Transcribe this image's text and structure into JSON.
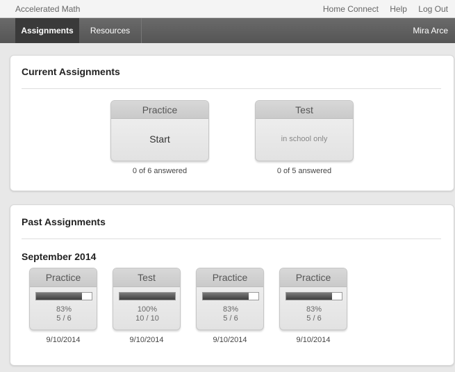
{
  "app": {
    "name": "Accelerated Math"
  },
  "top_links": [
    "Home Connect",
    "Help",
    "Log Out"
  ],
  "nav": {
    "tabs": [
      "Assignments",
      "Resources"
    ],
    "user": "Mira Arce"
  },
  "current": {
    "title": "Current Assignments",
    "cards": [
      {
        "type": "Practice",
        "action": "Start",
        "answered": "0 of 6 answered"
      },
      {
        "type": "Test",
        "action": "in school only",
        "answered": "0 of 5 answered"
      }
    ]
  },
  "past": {
    "title": "Past Assignments",
    "month": "September 2014",
    "cards": [
      {
        "type": "Practice",
        "percent": "83%",
        "score": "5 / 6",
        "progress": 0.83,
        "date": "9/10/2014"
      },
      {
        "type": "Test",
        "percent": "100%",
        "score": "10 / 10",
        "progress": 1.0,
        "date": "9/10/2014"
      },
      {
        "type": "Practice",
        "percent": "83%",
        "score": "5 / 6",
        "progress": 0.83,
        "date": "9/10/2014"
      },
      {
        "type": "Practice",
        "percent": "83%",
        "score": "5 / 6",
        "progress": 0.83,
        "date": "9/10/2014"
      }
    ]
  }
}
